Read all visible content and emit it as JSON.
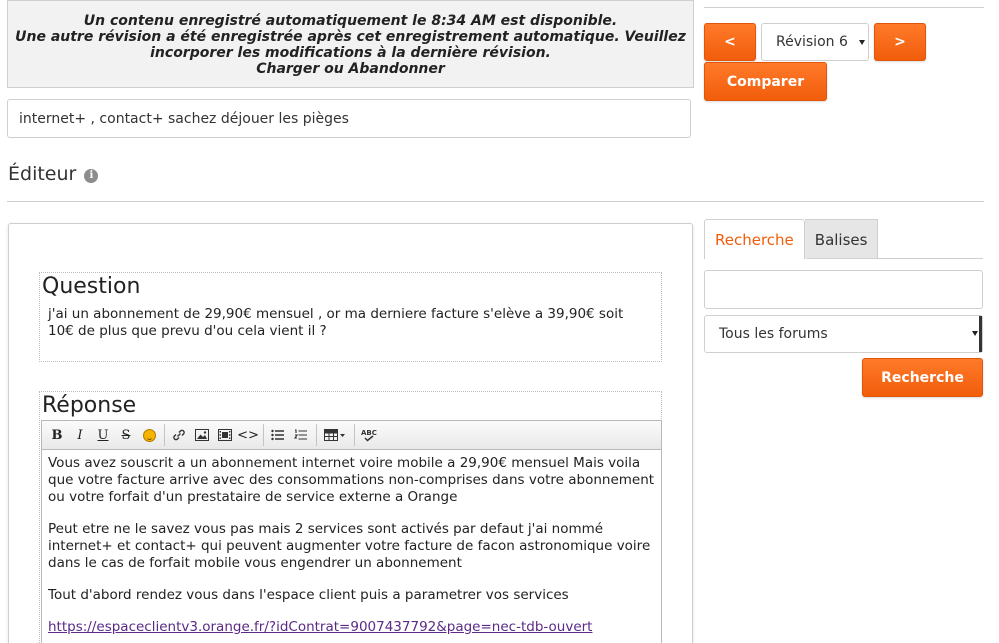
{
  "autosave_notice": {
    "line1": "Un contenu enregistré automatiquement le 8:34 AM est disponible.",
    "line2": "Une autre révision a été enregistrée après cet enregistrement automatique. Veuillez",
    "line3": "incorporer les modifications à la dernière révision.",
    "line4": "Charger ou Abandonner"
  },
  "title_input": {
    "value": "internet+ , contact+ sachez déjouer les pièges"
  },
  "editor": {
    "heading": "Éditeur",
    "info_icon": "info-icon"
  },
  "question": {
    "heading": "Question",
    "body": "j'ai un abonnement de 29,90€ mensuel , or ma derniere facture s'elève a 39,90€ soit 10€ de plus que prevu d'ou cela vient il ?"
  },
  "response": {
    "heading": "Réponse",
    "toolbar": {
      "bold": "B",
      "italic": "I",
      "underline": "U",
      "strike": "S",
      "code": "<>"
    },
    "paragraphs": [
      "Vous avez souscrit a un abonnement internet voire mobile a 29,90€ mensuel Mais voila que votre facture arrive avec des consommations non-comprises dans votre abonnement ou votre forfait d'un prestataire de service externe a Orange",
      "Peut etre ne le savez vous pas mais  2 services sont activés par defaut  j'ai nommé internet+ et contact+ qui peuvent augmenter votre facture de facon astronomique voire dans le cas de forfait mobile vous engendrer un abonnement",
      "Tout d'abord rendez vous dans l'espace client puis a parametrer vos services"
    ],
    "link": "https://espaceclientv3.orange.fr/?idContrat=9007437792&page=nec-tdb-ouvert"
  },
  "revision_nav": {
    "prev_label": "<",
    "next_label": ">",
    "selected_revision": "Révision 6",
    "compare_label": "Comparer"
  },
  "sidebar": {
    "tabs": [
      {
        "label": "Recherche",
        "active": true
      },
      {
        "label": "Balises",
        "active": false
      }
    ],
    "search_placeholder": "",
    "forum_select": "Tous les forums",
    "search_button": "Recherche"
  },
  "colors": {
    "accent": "#f15d0b",
    "link": "#5a2a86"
  }
}
